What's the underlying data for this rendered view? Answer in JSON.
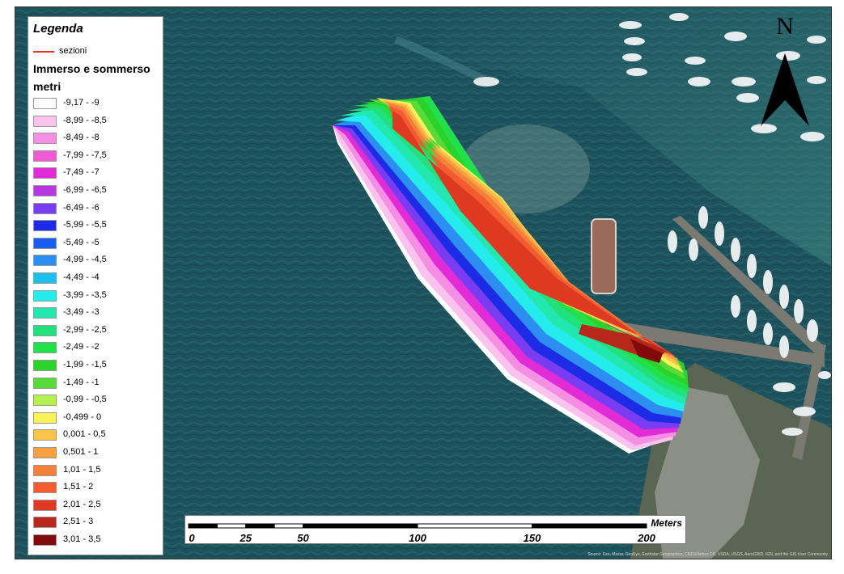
{
  "map": {
    "north_label": "N",
    "attribution": "Source: Esri, Maxar, GeoEye, Earthstar Geographics, CNES/Airbus DS, USDA, USGS, AeroGRID, IGN, and the GIS User Community",
    "colors": {
      "sea": "#1f5560",
      "land": "#5b6a55",
      "pier": "#7a7a72"
    }
  },
  "legend": {
    "title": "Legenda",
    "sections_label": "sezioni",
    "sections_color": "#e0302a",
    "layer_name": "Immerso e sommerso",
    "unit": "metri",
    "classes": [
      {
        "label": "-9,17 - -9",
        "color": "#ffffff"
      },
      {
        "label": "-8,99 - -8,5",
        "color": "#f9c3ee"
      },
      {
        "label": "-8,49 - -8",
        "color": "#f58fe4"
      },
      {
        "label": "-7,99 - -7,5",
        "color": "#f05ad6"
      },
      {
        "label": "-7,49 - -7",
        "color": "#e02bd6"
      },
      {
        "label": "-6,99 - -6,5",
        "color": "#b43ae0"
      },
      {
        "label": "-6,49 - -6",
        "color": "#7a3cf0"
      },
      {
        "label": "-5,99 - -5,5",
        "color": "#1d2be6"
      },
      {
        "label": "-5,49 - -5",
        "color": "#1a5cf0"
      },
      {
        "label": "-4,99 - -4,5",
        "color": "#2d8ef2"
      },
      {
        "label": "-4,49 - -4",
        "color": "#1fbef0"
      },
      {
        "label": "-3,99 - -3,5",
        "color": "#25ecec"
      },
      {
        "label": "-3,49 - -3",
        "color": "#22e8b0"
      },
      {
        "label": "-2,99 - -2,5",
        "color": "#22e07c"
      },
      {
        "label": "-2,49 - -2",
        "color": "#22e04a"
      },
      {
        "label": "-1,99 - -1,5",
        "color": "#2ad22a"
      },
      {
        "label": "-1,49 - -1",
        "color": "#5ada3a"
      },
      {
        "label": "-0,99 - -0,5",
        "color": "#b6f050"
      },
      {
        "label": "-0,499 - 0",
        "color": "#fbf25a"
      },
      {
        "label": "0,001 - 0,5",
        "color": "#fbc34a"
      },
      {
        "label": "0,501 - 1",
        "color": "#f9a040"
      },
      {
        "label": "1,01 - 1,5",
        "color": "#f5803a"
      },
      {
        "label": "1,51 - 2",
        "color": "#f25c30"
      },
      {
        "label": "2,01 - 2,5",
        "color": "#de3a22"
      },
      {
        "label": "2,51 - 3",
        "color": "#b8281a"
      },
      {
        "label": "3,01 - 3,5",
        "color": "#820a0a"
      }
    ]
  },
  "scalebar": {
    "unit": "Meters",
    "ticks": [
      {
        "value": 0,
        "label": "0"
      },
      {
        "value": 25,
        "label": "25"
      },
      {
        "value": 50,
        "label": "50"
      },
      {
        "value": 100,
        "label": "100"
      },
      {
        "value": 150,
        "label": "150"
      },
      {
        "value": 200,
        "label": "200"
      }
    ]
  }
}
